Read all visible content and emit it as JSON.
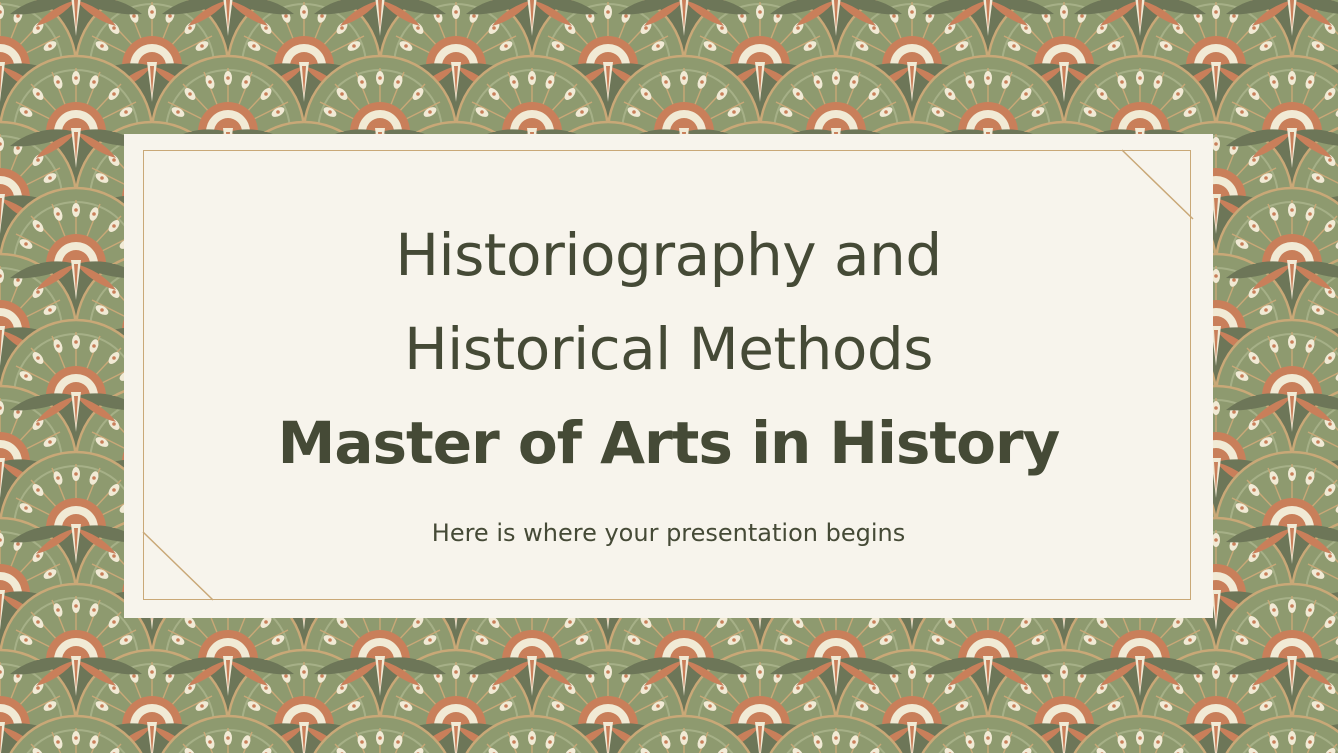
{
  "slide": {
    "title_line1": "Historiography and",
    "title_line2": "Historical Methods",
    "title_line3": "Master of Arts in History",
    "subtitle": "Here is where your presentation begins"
  },
  "colors": {
    "pattern_dark_green": "#6d7658",
    "pattern_mid_green": "#8e9a6f",
    "pattern_light_green": "#a6b087",
    "pattern_gold": "#c9a877",
    "pattern_terracotta": "#c97f5a",
    "pattern_cream": "#f1ead5",
    "card_background": "#f7f4ec",
    "card_border": "#c9a877",
    "text": "#454a36"
  },
  "decoration": {
    "background_motif": "peacock-fan-scale-pattern-icon",
    "corner_motif": "diagonal-corner-line-icon"
  }
}
